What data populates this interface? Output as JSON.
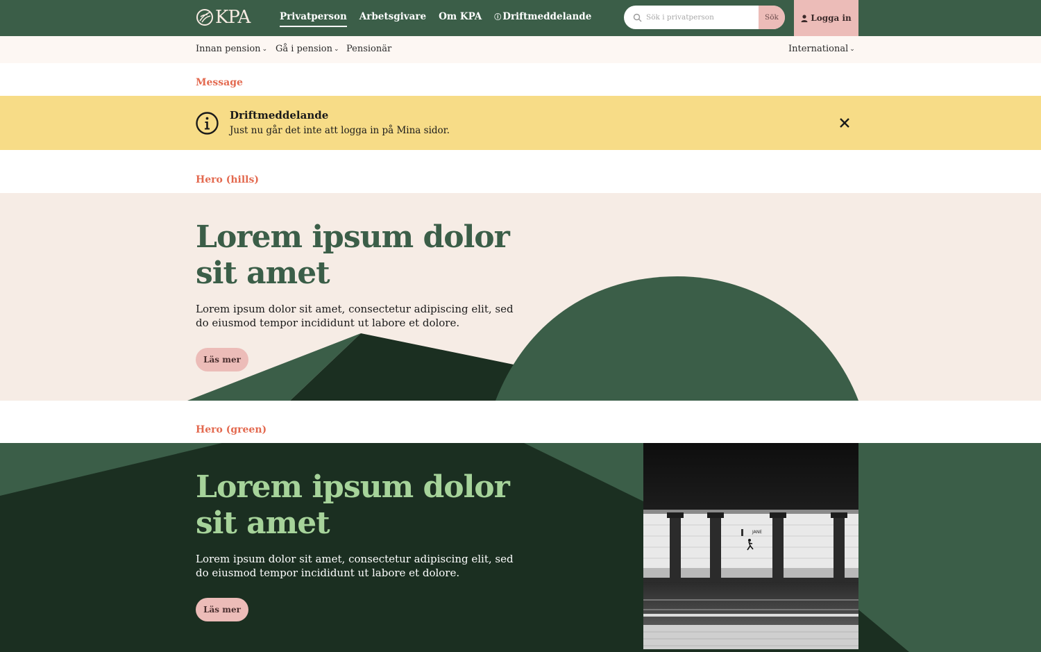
{
  "header": {
    "logo_text": "KPA",
    "nav": [
      {
        "label": "Privatperson",
        "active": true
      },
      {
        "label": "Arbetsgivare",
        "active": false
      },
      {
        "label": "Om KPA",
        "active": false
      },
      {
        "label": "Driftmeddelande",
        "active": false,
        "icon": "info-icon"
      }
    ],
    "search": {
      "placeholder": "Sök i privatperson",
      "value": "",
      "button_label": "Sök"
    },
    "login_label": "Logga in"
  },
  "subnav": {
    "items": [
      {
        "label": "Innan pension",
        "has_dropdown": true
      },
      {
        "label": "Gå i pension",
        "has_dropdown": true
      },
      {
        "label": "Pensionär",
        "has_dropdown": false
      }
    ],
    "right_item": {
      "label": "International",
      "has_dropdown": true
    }
  },
  "message_section": {
    "label": "Message",
    "title": "Driftmeddelande",
    "text": "Just nu går det inte att logga in på Mina sidor."
  },
  "hero_hills": {
    "label": "Hero (hills)",
    "title": "Lorem ipsum dolor sit amet",
    "text": "Lorem ipsum dolor sit amet, consectetur adipiscing elit, sed do eiusmod tempor incididunt ut labore et dolore.",
    "button_label": "Läs mer"
  },
  "hero_green": {
    "label": "Hero (green)",
    "title": "Lorem ipsum dolor sit amet",
    "text": "Lorem ipsum dolor sit amet, consectetur adipiscing elit, sed do eiusmod tempor incididunt ut labore et dolore.",
    "button_label": "Läs mer",
    "photo_sign_text": "JANE"
  },
  "colors": {
    "brand_green": "#3b5e48",
    "dark_green": "#1b2f21",
    "cream": "#f6ece5",
    "pink": "#ecbcb8",
    "label_orange": "#e3694f",
    "message_yellow": "#f7dc87",
    "light_green_title": "#a6d39a"
  }
}
